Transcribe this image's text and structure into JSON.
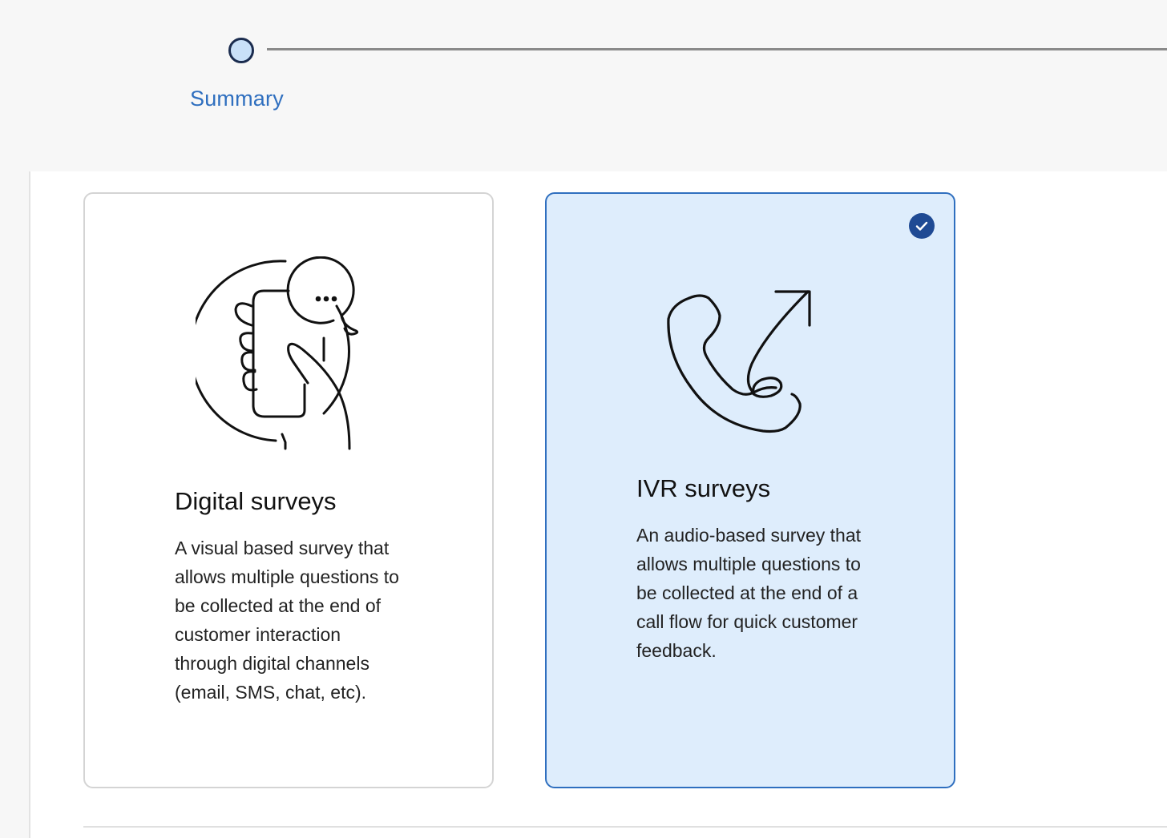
{
  "stepper": {
    "step_label": "Summary"
  },
  "cards": [
    {
      "title": "Digital surveys",
      "description": "A visual based survey that allows multiple questions to be collected at the end of customer interaction through digital channels (email, SMS, chat, etc).",
      "selected": false,
      "icon": "phone-chat-hand-illustration"
    },
    {
      "title": "IVR surveys",
      "description": "An audio-based survey that allows multiple questions to be collected at the end of a call flow for quick customer feedback.",
      "selected": true,
      "icon": "phone-outgoing-illustration"
    }
  ],
  "colors": {
    "accent": "#2f6fbf",
    "selected_bg": "#deedfc",
    "check_bg": "#1f4a94"
  }
}
